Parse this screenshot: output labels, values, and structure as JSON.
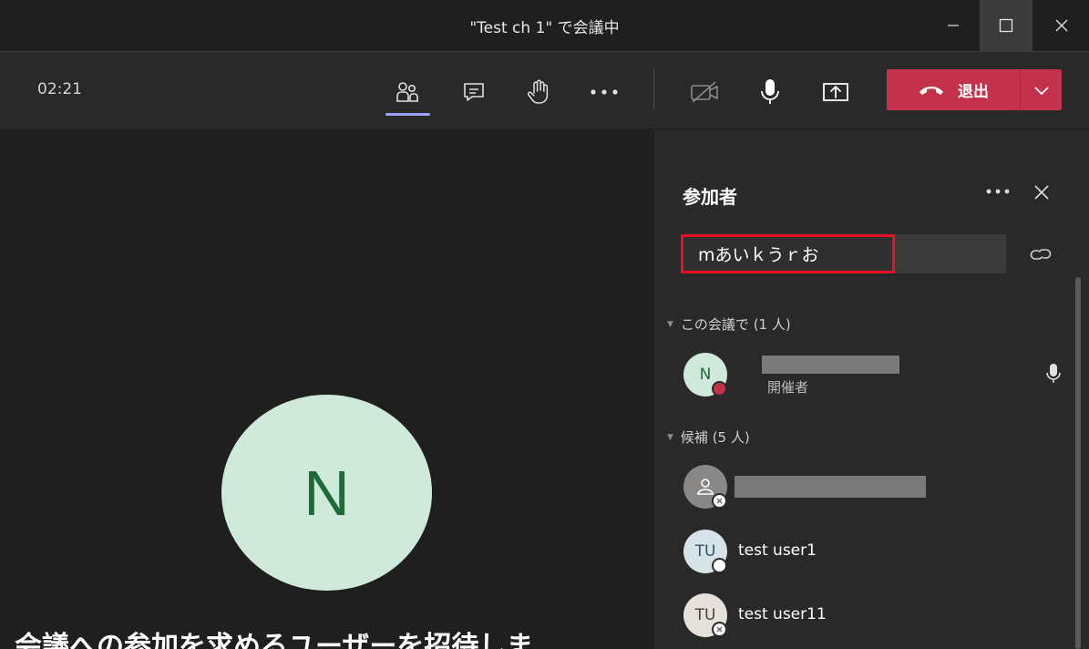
{
  "window": {
    "title": "\"Test ch 1\" で会議中"
  },
  "toolbar": {
    "timer": "02:21",
    "leave_label": "退出",
    "icons": [
      "people-icon",
      "chat-icon",
      "raise-hand-icon",
      "more-icon",
      "camera-off-icon",
      "microphone-icon",
      "share-screen-icon",
      "phone-hangup-icon",
      "chevron-down-icon"
    ]
  },
  "stage": {
    "avatar_initial": "N",
    "invite_text": "会議への参加を求めるユーザーを招待しま"
  },
  "panel": {
    "title": "参加者",
    "search_value": "mあいｋうｒお",
    "in_meeting": {
      "header": "この会議で (1 人)",
      "people": [
        {
          "initials": "N",
          "role": "開催者",
          "avatar_color": "#cfe9db",
          "initials_color": "#1e6b3a",
          "status_color": "#c4314b"
        }
      ]
    },
    "suggestions": {
      "header": "候補 (5 人)",
      "people": [
        {
          "initials": "",
          "name": "",
          "avatar_color": "#8a8886",
          "status": "offline"
        },
        {
          "initials": "TU",
          "name": "test user1",
          "avatar_color": "#d6e4ea",
          "initials_color": "#31546b",
          "status": "available"
        },
        {
          "initials": "TU",
          "name": "test user11",
          "avatar_color": "#e6e0da",
          "initials_color": "#4a3f36",
          "status": "offline"
        }
      ]
    }
  }
}
